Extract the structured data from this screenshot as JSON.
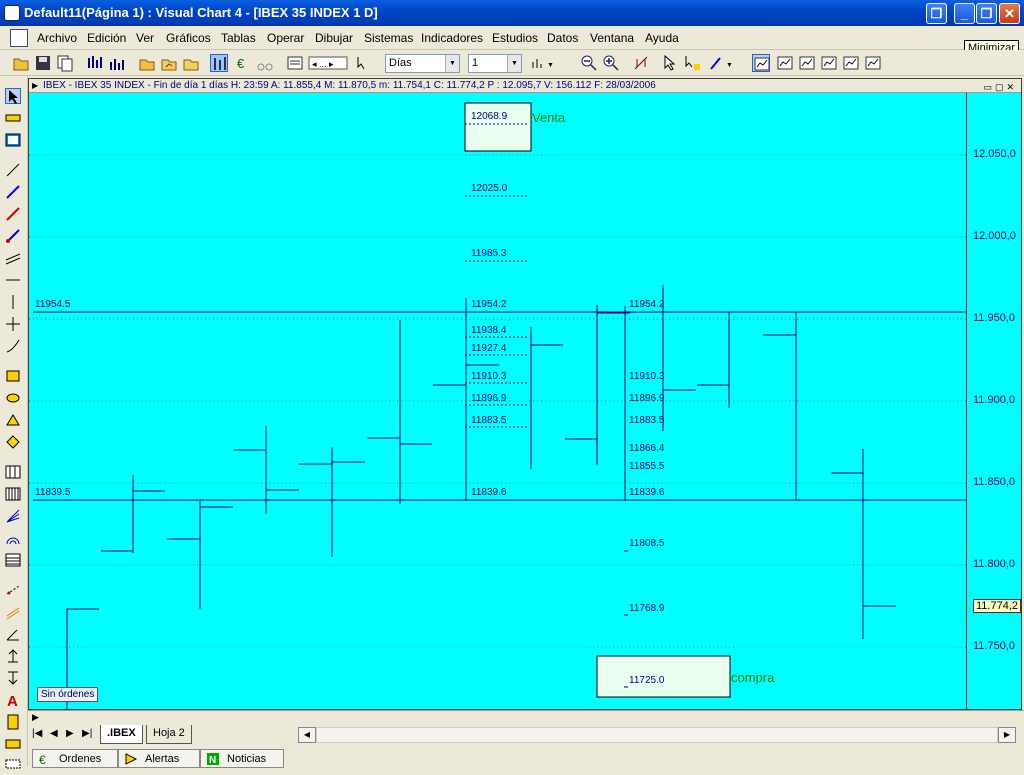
{
  "window": {
    "title": "Default11(Página 1) : Visual Chart 4 - [IBEX 35 INDEX 1 D]",
    "tooltip": "Minimizar"
  },
  "menu": [
    "Archivo",
    "Edición",
    "Ver",
    "Gráficos",
    "Tablas",
    "Operar",
    "Dibujar",
    "Sistemas",
    "Indicadores",
    "Estudios",
    "Datos",
    "Ventana",
    "Ayuda"
  ],
  "toolbar": {
    "period_combo": "Días",
    "count_combo": "1"
  },
  "chart": {
    "caption": "IBEX - IBEX 35 INDEX - Fin de día 1 días  H: 23:59  A: 11.855,4  M: 11.870,5  m: 11.754,1  C: 11.774,2  P : 12.095,7  V: 156.112  F: 28/03/2006",
    "venta_label": "Venta",
    "compra_label": "compra",
    "orders_tag": "Sin órdenes",
    "last_price": "11.774,2",
    "axis_ticks": [
      "12.050,0",
      "12.000,0",
      "11.950,0",
      "11.900,0",
      "11.850,0",
      "11.800,0",
      "11.750,0"
    ],
    "left_levels": [
      "11954.5",
      "11839.5"
    ],
    "mid_levels": [
      "12068.9",
      "12025.0",
      "11985.3",
      "11954.2",
      "11938.4",
      "11927.4",
      "11910.3",
      "11896.9",
      "11883.5",
      "11839.6"
    ],
    "right_levels": [
      "11954.2",
      "11910.3",
      "11896.9",
      "11883.5",
      "11866.4",
      "11855.5",
      "11839.6",
      "11808.5",
      "11768.9",
      "11725.0"
    ]
  },
  "sheets": {
    "nav": [
      "|◀",
      "◀",
      "▶",
      "▶|"
    ],
    "tabs": [
      ".IBEX",
      "Hoja 2"
    ]
  },
  "bottom_tabs": [
    "Ordenes",
    "Alertas",
    "Noticias"
  ],
  "colors": {
    "chart_bg": "#00ffff",
    "bars": "#000080",
    "box_fill": "#e8fff0",
    "label_green": "#008000"
  }
}
